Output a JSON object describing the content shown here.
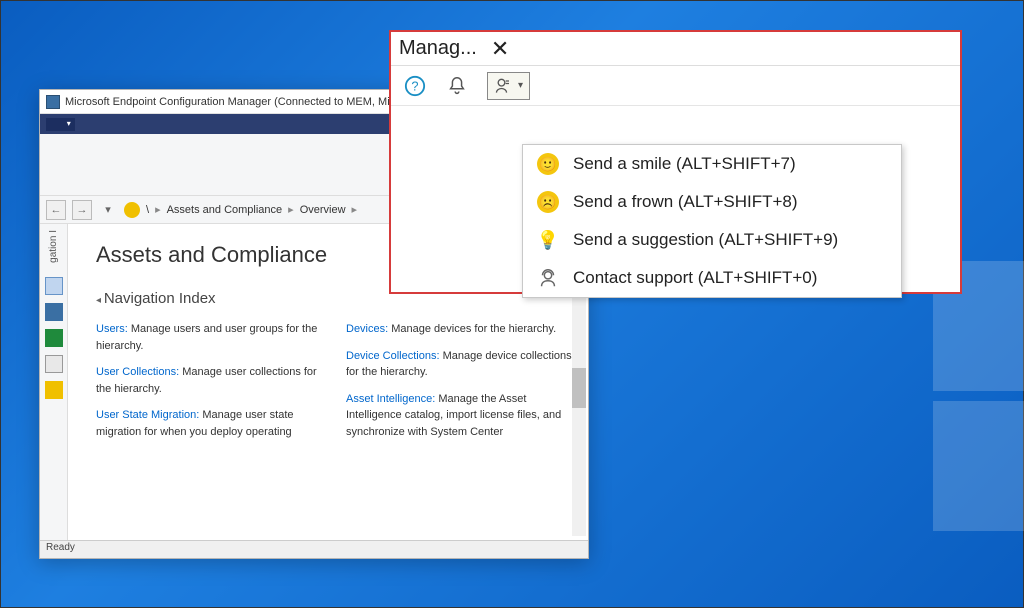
{
  "app": {
    "title": "Microsoft Endpoint Configuration Manager (Connected to MEM, Mi"
  },
  "breadcrumb": {
    "root": "\\",
    "seg1": "Assets and Compliance",
    "seg2": "Overview"
  },
  "side": {
    "vtab": "gation I"
  },
  "main": {
    "heading": "Assets and Compliance",
    "navindex": "Navigation Index",
    "items": {
      "users": {
        "label": "Users:",
        "desc": " Manage users and user groups for the hierarchy."
      },
      "usercoll": {
        "label": "User Collections:",
        "desc": " Manage user collections for the hierarchy."
      },
      "usm": {
        "label": "User State Migration:",
        "desc": " Manage user state migration for when you deploy operating"
      },
      "devices": {
        "label": "Devices:",
        "desc": " Manage devices for the hierarchy."
      },
      "devcoll": {
        "label": "Device Collections:",
        "desc": " Manage device collections for the hierarchy."
      },
      "ai": {
        "label": "Asset Intelligence:",
        "desc": " Manage the Asset Intelligence catalog, import license files, and synchronize with System Center"
      }
    }
  },
  "status": {
    "ready": "Ready"
  },
  "overlay": {
    "title": "Manag...",
    "menu": {
      "smile": "Send a smile (ALT+SHIFT+7)",
      "frown": "Send a frown (ALT+SHIFT+8)",
      "suggestion": "Send a suggestion (ALT+SHIFT+9)",
      "contact": "Contact support (ALT+SHIFT+0)"
    }
  }
}
